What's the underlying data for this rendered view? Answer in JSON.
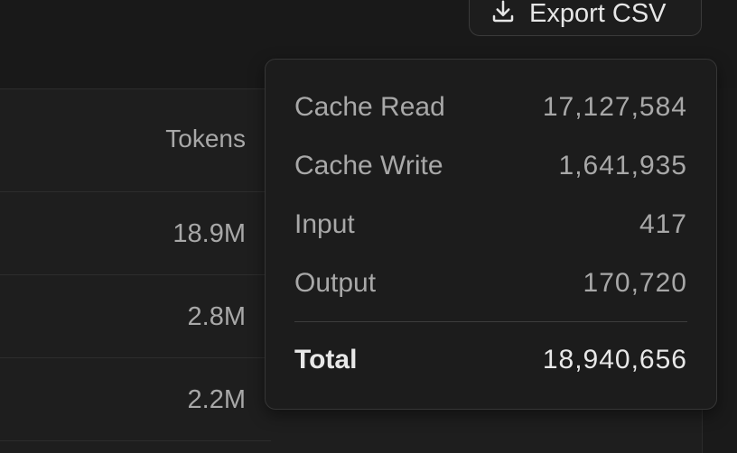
{
  "toolbar": {
    "export_label": "Export CSV"
  },
  "table": {
    "column_header": "Tokens",
    "rows": [
      {
        "tokens": "18.9M"
      },
      {
        "tokens": "2.8M"
      },
      {
        "tokens": "2.2M"
      }
    ]
  },
  "tooltip": {
    "rows": [
      {
        "label": "Cache Read",
        "value": "17,127,584"
      },
      {
        "label": "Cache Write",
        "value": "1,641,935"
      },
      {
        "label": "Input",
        "value": "417"
      },
      {
        "label": "Output",
        "value": "170,720"
      }
    ],
    "total": {
      "label": "Total",
      "value": "18,940,656"
    }
  },
  "icons": {
    "export": "download-icon"
  }
}
